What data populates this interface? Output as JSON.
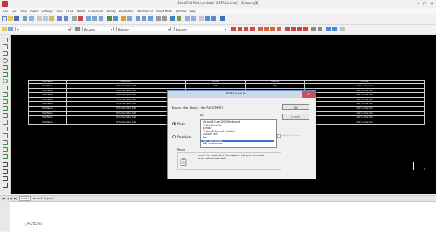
{
  "window": {
    "title": "BricsCAD Platinum beta (BETA License) - [Drawing1]",
    "minimize": "–",
    "maximize": "□",
    "close": "✕"
  },
  "menu": [
    "File",
    "Edit",
    "View",
    "Insert",
    "Settings",
    "Tools",
    "Draw",
    "Model",
    "Dimension",
    "Modify",
    "Parametric",
    "Mechanical",
    "Sheet Metal",
    "Window",
    "Help"
  ],
  "toolbar": {
    "layer_combo": "0",
    "color_combo": "ByLayer",
    "linetype_combo": "ByLayer",
    "lineweight_combo": "ByLayer"
  },
  "layout_tabs": [
    "Model",
    "Layout1",
    "Layout2"
  ],
  "command": {
    "history": "------------------------------",
    "prompt": ": _PASTESPEC"
  },
  "table": {
    "headers": [
      "Item Name",
      "Description",
      "Part Nbr",
      "Quantity",
      "Sub Desc"
    ],
    "cell_placeholders": [
      "Item Name",
      "Parts Description text",
      "Part",
      "Qty",
      "Part Sub Desc text"
    ],
    "row_count": 9
  },
  "dialog": {
    "title": "Paste Special",
    "source_label": "Source:",
    "source_value": "Mac Sketch: Mac/PRJ/1/PARTS",
    "as_label": "As:",
    "paste_label": "Paste",
    "paste_link_label": "Paste Link",
    "ok_label": "OK",
    "cancel_label": "Cancel",
    "display_as_icon_label": "Display As Icon",
    "result_label": "Result",
    "result_text": "Inserts the contents of the clipboard into your document as an unformatted table.",
    "as_options": [
      "Microsoft Excel 2003 Worksheet",
      "Picture (Metafile)",
      "Bitmap",
      "Picture (Enhanced Metafile)",
      "Unicode Text",
      "Text",
      "Rich Text Format",
      "XML Spreadsheet"
    ],
    "selected_index": 6
  },
  "ucs": {
    "x": "X",
    "y": "Y"
  },
  "colors": {
    "canvas": "#000000",
    "selection": "#3975d9",
    "dialog_close": "#c7505a"
  }
}
